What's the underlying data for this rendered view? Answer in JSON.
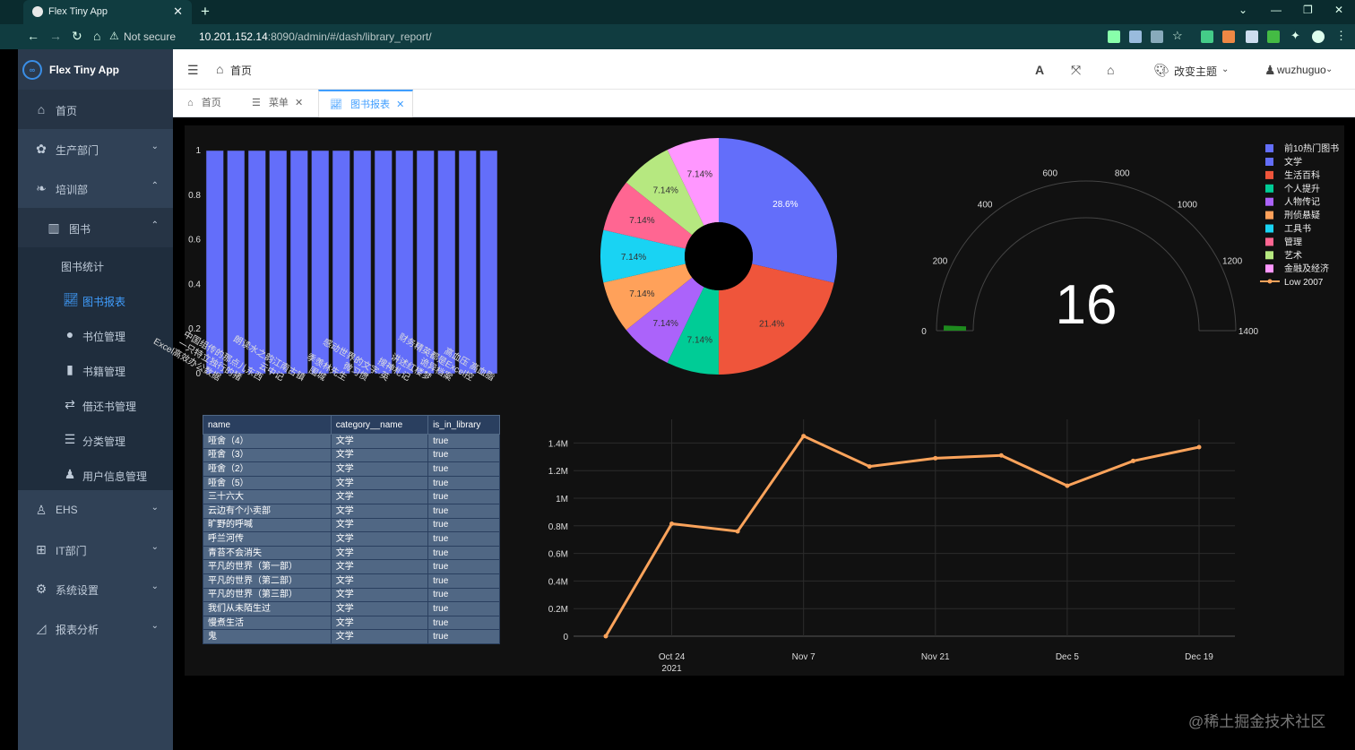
{
  "browser": {
    "tab_title": "Flex Tiny App",
    "not_secure": "Not secure",
    "url_host": "10.201.152.14",
    "url_rest": ":8090/admin/#/dash/library_report/"
  },
  "sidebar": {
    "app_name": "Flex Tiny App",
    "logo_text": "∞",
    "items": [
      {
        "label": "首页",
        "icon": "home-icon"
      },
      {
        "label": "生产部门",
        "icon": "paw-icon"
      },
      {
        "label": "培训部",
        "icon": "leaf-icon"
      },
      {
        "label": "图书",
        "icon": "book-open-icon"
      },
      {
        "label": "图书统计",
        "icon": "blank-icon"
      },
      {
        "label": "图书报表",
        "icon": "chart-line-icon"
      },
      {
        "label": "书位管理",
        "icon": "map-marker-icon"
      },
      {
        "label": "书籍管理",
        "icon": "book-icon"
      },
      {
        "label": "借还书管理",
        "icon": "exchange-icon"
      },
      {
        "label": "分类管理",
        "icon": "list-icon"
      },
      {
        "label": "用户信息管理",
        "icon": "user-icon"
      },
      {
        "label": "EHS",
        "icon": "user-shield-icon"
      },
      {
        "label": "IT部门",
        "icon": "windows-icon"
      },
      {
        "label": "系统设置",
        "icon": "gear-icon"
      },
      {
        "label": "报表分析",
        "icon": "chart-area-icon"
      }
    ]
  },
  "header": {
    "breadcrumb": "首页",
    "theme_label": "改变主题",
    "username": "wuzhuguo"
  },
  "tags": [
    {
      "label": "首页"
    },
    {
      "label": "菜单"
    },
    {
      "label": "图书报表"
    }
  ],
  "bar_chart": {
    "type": "bar",
    "categories": [
      "Excel高效办公数据",
      "一只特立独行的猪",
      "中国组传的那点儿东西",
      "云中记",
      "朗读水之韵江南古镇",
      "围城",
      "季羡林先生",
      "微习惯",
      "感动世界的文字·英",
      "搜神札记",
      "讲述红楼梦",
      "诡异档案",
      "财务精英都是Excel控",
      "高血压 高血脂"
    ],
    "values": [
      1,
      1,
      1,
      1,
      1,
      1,
      1,
      1,
      1,
      1,
      1,
      1,
      1,
      1
    ],
    "yticks": [
      "0",
      "0.2",
      "0.4",
      "0.6",
      "0.8",
      "1"
    ],
    "ylim": [
      0,
      1
    ],
    "color": "#636efa"
  },
  "chart_data": [
    {
      "type": "pie",
      "hole": true,
      "labels": [
        "文学",
        "生活百科",
        "个人提升",
        "人物传记",
        "刑侦悬疑",
        "工具书",
        "管理",
        "艺术",
        "金融及经济"
      ],
      "values": [
        28.6,
        21.4,
        7.14,
        7.14,
        7.14,
        7.14,
        7.14,
        7.14,
        7.14
      ],
      "value_labels": [
        "28.6%",
        "21.4%",
        "7.14%",
        "7.14%",
        "7.14%",
        "7.14%",
        "7.14%",
        "7.14%",
        "7.14%"
      ],
      "colors": [
        "#636efa",
        "#ef553b",
        "#00cc96",
        "#ab63fa",
        "#ffa15a",
        "#19d3f3",
        "#ff6692",
        "#b6e880",
        "#ff97ff"
      ]
    },
    {
      "type": "gauge",
      "value": 16,
      "value_text": "16",
      "range": [
        0,
        1400
      ],
      "ticks": [
        "0",
        "200",
        "400",
        "600",
        "800",
        "1000",
        "1200",
        "1400"
      ],
      "bar_color": "#1e8a1e"
    },
    {
      "type": "line",
      "series": [
        {
          "name": "Low 2007",
          "color": "#fba35b"
        }
      ],
      "x": [
        "2021-10-17",
        "2021-10-24",
        "2021-10-31",
        "2021-11-07",
        "2021-11-14",
        "2021-11-21",
        "2021-11-28",
        "2021-12-05",
        "2021-12-12",
        "2021-12-19"
      ],
      "y": [
        0,
        815000,
        760000,
        1450000,
        1230000,
        1290000,
        1310000,
        1090000,
        1270000,
        1370000
      ],
      "xticks": [
        "Oct 24\n2021",
        "Nov 7",
        "Nov 21",
        "Dec 5",
        "Dec 19"
      ],
      "yticks": [
        "0",
        "0.2M",
        "0.4M",
        "0.6M",
        "0.8M",
        "1M",
        "1.2M",
        "1.4M"
      ],
      "ylim": [
        0,
        1500000
      ]
    },
    {
      "type": "table",
      "columns": [
        "name",
        "category__name",
        "is_in_library"
      ],
      "rows": [
        [
          "哑舍（4）",
          "文学",
          "true"
        ],
        [
          "哑舍（3）",
          "文学",
          "true"
        ],
        [
          "哑舍（2）",
          "文学",
          "true"
        ],
        [
          "哑舍（5）",
          "文学",
          "true"
        ],
        [
          "三十六大",
          "文学",
          "true"
        ],
        [
          "云边有个小卖部",
          "文学",
          "true"
        ],
        [
          "旷野的呼喊",
          "文学",
          "true"
        ],
        [
          "呼兰河传",
          "文学",
          "true"
        ],
        [
          "青苔不会消失",
          "文学",
          "true"
        ],
        [
          "平凡的世界（第一部）",
          "文学",
          "true"
        ],
        [
          "平凡的世界（第二部）",
          "文学",
          "true"
        ],
        [
          "平凡的世界（第三部）",
          "文学",
          "true"
        ],
        [
          "我们从未陌生过",
          "文学",
          "true"
        ],
        [
          "慢煮生活",
          "文学",
          "true"
        ],
        [
          "鬼",
          "文学",
          "true"
        ]
      ]
    }
  ],
  "legend": {
    "title": "前10热门图书",
    "entries": [
      "文学",
      "生活百科",
      "个人提升",
      "人物传记",
      "刑侦悬疑",
      "工具书",
      "管理",
      "艺术",
      "金融及经济"
    ],
    "line_entry": "Low 2007"
  },
  "watermark": "@稀土掘金技术社区"
}
